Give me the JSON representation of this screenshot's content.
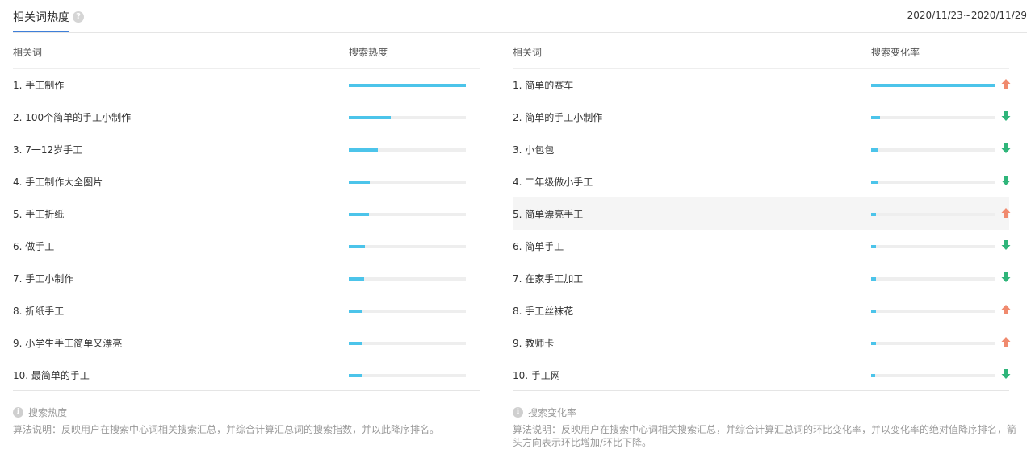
{
  "header": {
    "tab_label": "相关词热度",
    "help_glyph": "?",
    "date_range": "2020/11/23~2020/11/29"
  },
  "left_panel": {
    "col_term": "相关词",
    "col_metric": "搜索热度",
    "rows": [
      {
        "rank": "1.",
        "term": "手工制作",
        "level": 1.0
      },
      {
        "rank": "2.",
        "term": "100个简单的手工小制作",
        "level": 0.36
      },
      {
        "rank": "3.",
        "term": "7一12岁手工",
        "level": 0.25
      },
      {
        "rank": "4.",
        "term": "手工制作大全图片",
        "level": 0.18
      },
      {
        "rank": "5.",
        "term": "手工折纸",
        "level": 0.17
      },
      {
        "rank": "6.",
        "term": "做手工",
        "level": 0.14
      },
      {
        "rank": "7.",
        "term": "手工小制作",
        "level": 0.13
      },
      {
        "rank": "8.",
        "term": "折纸手工",
        "level": 0.12
      },
      {
        "rank": "9.",
        "term": "小学生手工简单又漂亮",
        "level": 0.11
      },
      {
        "rank": "10.",
        "term": "最简单的手工",
        "level": 0.11
      }
    ]
  },
  "right_panel": {
    "col_term": "相关词",
    "col_metric": "搜索变化率",
    "rows": [
      {
        "rank": "1.",
        "term": "简单的赛车",
        "level": 1.0,
        "trend": "up"
      },
      {
        "rank": "2.",
        "term": "简单的手工小制作",
        "level": 0.07,
        "trend": "down"
      },
      {
        "rank": "3.",
        "term": "小包包",
        "level": 0.06,
        "trend": "down"
      },
      {
        "rank": "4.",
        "term": "二年级做小手工",
        "level": 0.05,
        "trend": "down"
      },
      {
        "rank": "5.",
        "term": "简单漂亮手工",
        "level": 0.04,
        "trend": "up"
      },
      {
        "rank": "6.",
        "term": "简单手工",
        "level": 0.04,
        "trend": "down"
      },
      {
        "rank": "7.",
        "term": "在家手工加工",
        "level": 0.04,
        "trend": "down"
      },
      {
        "rank": "8.",
        "term": "手工丝袜花",
        "level": 0.04,
        "trend": "up"
      },
      {
        "rank": "9.",
        "term": "教师卡",
        "level": 0.04,
        "trend": "up"
      },
      {
        "rank": "10.",
        "term": "手工网",
        "level": 0.03,
        "trend": "down"
      }
    ]
  },
  "notes": {
    "info_glyph": "i",
    "left_title": "搜索热度",
    "left_text": "算法说明：反映用户在搜索中心词相关搜索汇总，并综合计算汇总词的搜索指数，并以此降序排名。",
    "right_title": "搜索变化率",
    "right_text": "算法说明：反映用户在搜索中心词相关搜索汇总，并综合计算汇总词的环比变化率，并以变化率的绝对值降序排名，箭头方向表示环比增加/环比下降。"
  },
  "colors": {
    "bar_fill": "#4cc4ea",
    "bar_track": "#eeeeee",
    "trend_up": "#f08a6e",
    "trend_down": "#2fb57a",
    "tab_accent": "#3e7fd9"
  }
}
